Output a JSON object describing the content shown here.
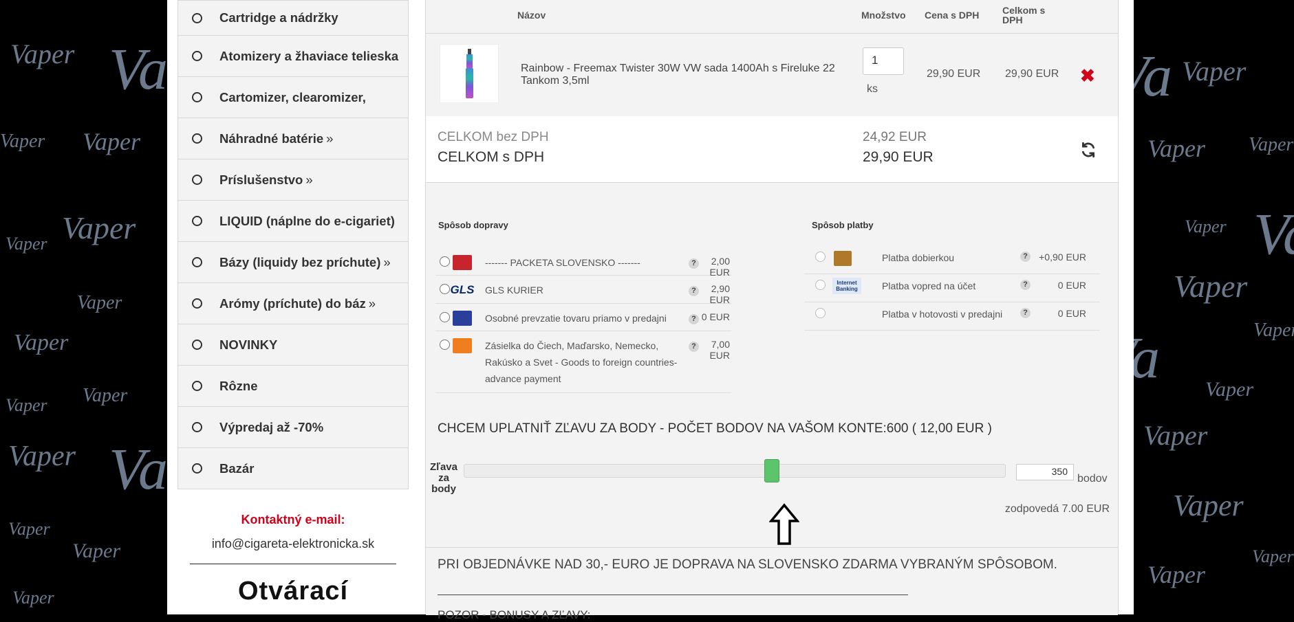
{
  "background": {
    "watermark_text": "Vaper"
  },
  "sidebar": {
    "items": [
      {
        "label": "Cartridge a nádržky",
        "arrow": ""
      },
      {
        "label": "Atomizery a žhaviace telieska",
        "arrow": ""
      },
      {
        "label": "Cartomizer, clearomizer,",
        "arrow": ""
      },
      {
        "label": "Náhradné batérie",
        "arrow": "»"
      },
      {
        "label": "Príslušenstvo",
        "arrow": "»"
      },
      {
        "label": "LIQUID (náplne do e-cigariet)",
        "arrow": ""
      },
      {
        "label": "Bázy (liquidy bez príchute)",
        "arrow": "»"
      },
      {
        "label": "Arómy (príchute) do báz",
        "arrow": "»"
      },
      {
        "label": "NOVINKY",
        "arrow": ""
      },
      {
        "label": "Rôzne",
        "arrow": ""
      },
      {
        "label": "Výpredaj až -70%",
        "arrow": ""
      },
      {
        "label": "Bazár",
        "arrow": ""
      }
    ]
  },
  "contact": {
    "title": "Kontaktný e-mail:",
    "email": "info@cigareta-elektronicka.sk",
    "next_heading": "Otvárací"
  },
  "cart": {
    "headers": {
      "name": "Názov",
      "qty": "Množstvo",
      "price": "Cena s DPH",
      "total": "Celkom s DPH"
    },
    "item": {
      "name": "Rainbow - Freemax Twister 30W VW sada 1400Ah s Fireluke 22 Tankom 3,5ml",
      "qty": "1",
      "unit": "ks",
      "price": "29,90 EUR",
      "total": "29,90 EUR"
    },
    "totals": {
      "without_vat_label": "CELKOM bez DPH",
      "without_vat_value": "24,92 EUR",
      "with_vat_label": "CELKOM s DPH",
      "with_vat_value": "29,90 EUR"
    }
  },
  "shipping": {
    "title": "Spôsob dopravy",
    "options": [
      {
        "label": "------- PACKETA SLOVENSKO -------",
        "price": "2,00 EUR",
        "logo": "packeta-logo"
      },
      {
        "label": "GLS KURIER",
        "price": "2,90 EUR",
        "logo": "gls-logo"
      },
      {
        "label": "Osobné prevzatie tovaru priamo v predajni",
        "price": "0 EUR",
        "logo": "store-logo"
      },
      {
        "label": "Zásielka do Čiech, Maďarsko, Nemecko, Rakúsko a Svet - Goods to foreign countries-advance payment",
        "price": "7,00 EUR",
        "logo": "parcel-logo"
      }
    ]
  },
  "payment": {
    "title": "Spôsob platby",
    "options": [
      {
        "label": "Platba dobierkou",
        "price": "+0,90 EUR",
        "logo": "wallet-logo"
      },
      {
        "label": "Platba vopred na účet",
        "price": "0 EUR",
        "logo": "internet-banking-logo",
        "logo_text": "Internet Banking"
      },
      {
        "label": "Platba v hotovosti v predajni",
        "price": "0 EUR",
        "logo": ""
      }
    ]
  },
  "points": {
    "title": "CHCEM UPLATNIŤ ZĽAVU ZA BODY - POČET BODOV NA VAŠOM KONTE:600 ( 12,00 EUR )",
    "slider_label": "Zľava za body",
    "value": "350",
    "max": 600,
    "unit": "bodov",
    "equivalent": "zodpovedá 7.00 EUR"
  },
  "info": {
    "line1": "PRI OBJEDNÁVKE NAD 30,- EURO JE DOPRAVA NA SLOVENSKO ZDARMA VYBRANÝM SPÔSOBOM.",
    "line2": "POZOR - BONUSY A ZĽAVY:"
  },
  "colors": {
    "accent_red": "#d0021b",
    "slider_green": "#5cc46a",
    "watermark": "#6b7a8c"
  }
}
